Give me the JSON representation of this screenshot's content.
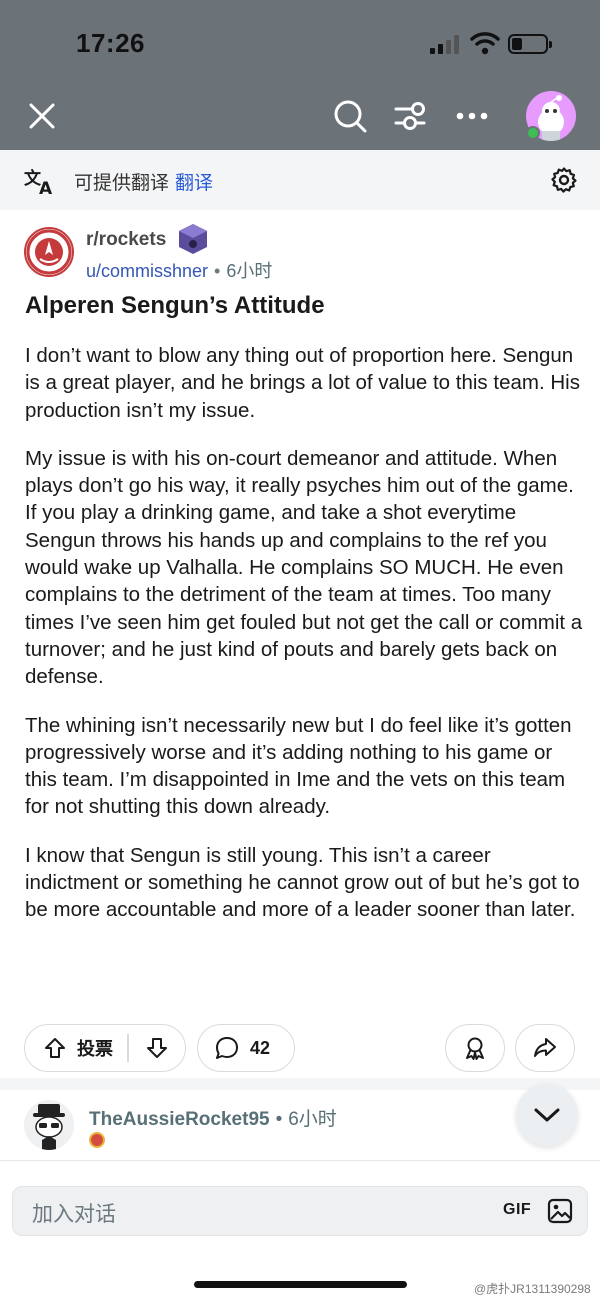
{
  "status_bar": {
    "time": "17:26"
  },
  "translate_bar": {
    "text": "可提供翻译",
    "link": "翻译"
  },
  "post": {
    "subreddit": "r/rockets",
    "author": "u/commisshner",
    "separator": "•",
    "time": "6小时",
    "title": "Alperen Sengun’s Attitude",
    "paragraphs": [
      "I don’t want to blow any thing out of proportion here. Sengun is a great player, and he brings a lot of value to this team. His production isn’t my issue.",
      "My issue is with his on-court demeanor and attitude. When plays don’t go his way, it really psyches him out of the game. If you play a drinking game, and take a shot everytime Sengun throws his hands up and complains to the ref you would wake up Valhalla. He complains SO MUCH. He even complains to the detriment of the team at times. Too many times I’ve seen him get fouled but not get the call or commit a turnover; and he just kind of pouts and barely gets back on defense.",
      "The whining isn’t necessarily new but I do feel like it’s gotten progressively worse and it’s adding nothing to his game or this team. I’m disappointed in Ime and the vets on this team for not shutting this down already.",
      "I know that Sengun is still young. This isn’t a career indictment or something he cannot grow out of but he’s got to be more accountable and more of a leader sooner than later."
    ]
  },
  "actions": {
    "vote_label": "投票",
    "comment_count": "42"
  },
  "comment_preview": {
    "username": "TheAussieRocket95",
    "separator": "•",
    "time": "6小时"
  },
  "composer": {
    "placeholder": "加入对话",
    "gif_label": "GIF"
  },
  "watermark": "@虎扑JR1311390298",
  "colors": {
    "header_bg": "#6b7278",
    "link_blue": "#2a5bd7",
    "avatar_pink": "#e79bff",
    "online_green": "#3dbd54"
  }
}
